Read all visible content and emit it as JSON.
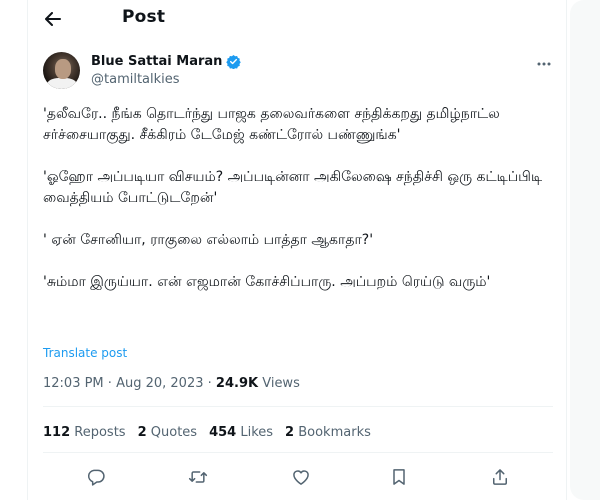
{
  "header": {
    "title": "Post"
  },
  "author": {
    "display_name": "Blue Sattai Maran",
    "handle": "@tamiltalkies",
    "verified": true
  },
  "tweet": {
    "paragraphs": [
      "'தலீவரே.. நீங்க தொடர்ந்து பாஜக தலைவர்களை சந்திக்கறது தமிழ்நாட்ல சர்ச்சையாகுது. சீக்கிரம் டேமேஜ் கண்ட்ரோல் பண்ணுங்க'",
      "'ஓஹோ அப்படியா விசயம்? அப்படின்னா அகிலேஷை சந்திச்சி ஒரு கட்டிப்பிடி வைத்தியம் போட்டுடறேன்'",
      "' ஏன் சோனியா, ராகுலை எல்லாம் பாத்தா ஆகாதா?'",
      "'சும்மா இருய்யா. என் எஜமான் கோச்சிப்பாரு. அப்பறம் ரெய்டு வரும்'"
    ],
    "translate_label": "Translate post"
  },
  "meta": {
    "time": "12:03 PM",
    "separator": "·",
    "date": "Aug 20, 2023",
    "views_count": "24.9K",
    "views_label": "Views"
  },
  "stats": {
    "reposts_count": "112",
    "reposts_label": "Reposts",
    "quotes_count": "2",
    "quotes_label": "Quotes",
    "likes_count": "454",
    "likes_label": "Likes",
    "bookmarks_count": "2",
    "bookmarks_label": "Bookmarks"
  },
  "icons": {
    "back": "arrow-left-icon",
    "verified": "verified-badge-icon",
    "more": "more-horizontal-icon",
    "reply": "reply-icon",
    "repost": "repost-icon",
    "like": "heart-icon",
    "bookmark": "bookmark-icon",
    "share": "share-icon"
  },
  "colors": {
    "accent": "#1d9bf0",
    "text_primary": "#0f1419",
    "text_secondary": "#536471",
    "divider": "#eff3f4"
  }
}
